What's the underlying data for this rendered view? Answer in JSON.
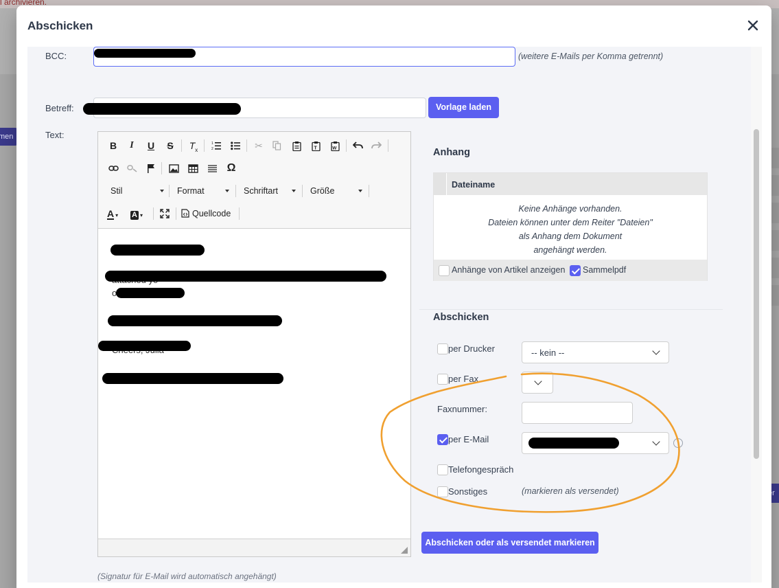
{
  "background": {
    "top_text": "l archivieren.",
    "left_button_text": "men",
    "right_button_text": "er"
  },
  "modal": {
    "title": "Abschicken",
    "close_icon": "close-icon"
  },
  "form": {
    "bcc_label": "BCC:",
    "bcc_hint": "(weitere E-Mails per Komma getrennt)",
    "subject_label": "Betreff:",
    "load_template_button": "Vorlage laden",
    "text_label": "Text:"
  },
  "editor": {
    "toolbar_row1": [
      "bold-icon",
      "italic-icon",
      "underline-icon",
      "strikethrough-icon",
      "clear-format-icon",
      "numbered-list-icon",
      "bullet-list-icon",
      "cut-icon",
      "copy-icon",
      "paste-icon",
      "paste-text-icon",
      "paste-word-icon",
      "undo-icon",
      "redo-icon"
    ],
    "toolbar_row2": [
      "link-icon",
      "unlink-icon",
      "anchor-flag-icon",
      "image-icon",
      "table-icon",
      "horizontal-line-icon",
      "omega-icon"
    ],
    "style_combo": "Stil",
    "format_combo": "Format",
    "font_combo": "Schriftart",
    "size_combo": "Größe",
    "source_button": "Quellcode",
    "body_fragments": [
      "attached yo",
      "o",
      "Cheers, Julia"
    ]
  },
  "attachments": {
    "title": "Anhang",
    "column_header": "Dateiname",
    "empty_lines": [
      "Keine Anhänge vorhanden.",
      "Dateien können unter dem Reiter \"Dateien\"",
      "als Anhang dem Dokument",
      "angehängt werden."
    ],
    "show_article_attachments_label": "Anhänge von Artikel anzeigen",
    "show_article_attachments_checked": false,
    "collective_pdf_label": "Sammelpdf",
    "collective_pdf_checked": true
  },
  "send": {
    "title": "Abschicken",
    "printer_label": "per Drucker",
    "printer_checked": false,
    "printer_select_value": "-- kein --",
    "fax_label": "per Fax",
    "fax_checked": false,
    "fax_number_label": "Faxnummer:",
    "email_label": "per E-Mail",
    "email_checked": true,
    "phone_label": "Telefongespräch",
    "phone_checked": false,
    "other_label": "Sonstiges",
    "other_checked": false,
    "other_hint": "(markieren als versendet)",
    "submit_button": "Abschicken oder als versendet markieren"
  },
  "footer_fragment": "(Signatur für E-Mail wird automatisch angehängt)",
  "colors": {
    "accent": "#5b5ff0",
    "annotation": "#f0a030"
  }
}
